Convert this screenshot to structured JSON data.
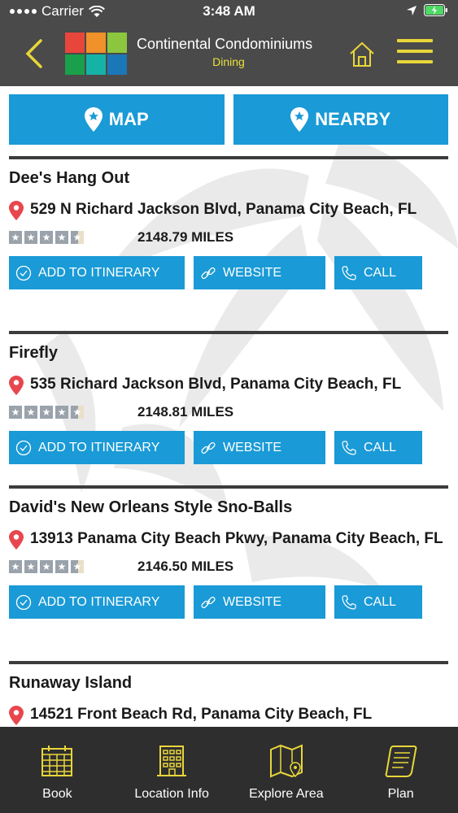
{
  "status_bar": {
    "carrier": "Carrier",
    "time": "3:48 AM"
  },
  "header": {
    "title": "Continental Condominiums",
    "subtitle": "Dining",
    "logo_colors": [
      "#e8463b",
      "#f0912a",
      "#8cc63f",
      "#1aa04a",
      "#15b3a6",
      "#1a78b8"
    ]
  },
  "actions": {
    "map_label": "MAP",
    "nearby_label": "NEARBY"
  },
  "listings": [
    {
      "name": "Dee's Hang Out",
      "address": "529 N Richard Jackson Blvd, Panama City Beach, FL",
      "distance": "2148.79 MILES",
      "rating": 4.5
    },
    {
      "name": "Firefly",
      "address": "535 Richard Jackson Blvd, Panama City Beach, FL",
      "distance": "2148.81 MILES",
      "rating": 4.5
    },
    {
      "name": "David's New Orleans Style Sno-Balls",
      "address": "13913 Panama City Beach Pkwy, Panama City Beach, FL",
      "distance": "2146.50 MILES",
      "rating": 4.5
    },
    {
      "name": "Runaway Island",
      "address": "14521 Front Beach Rd, Panama City Beach, FL",
      "distance": "",
      "rating": 0
    }
  ],
  "button_labels": {
    "itinerary": "ADD TO ITINERARY",
    "website": "WEBSITE",
    "call": "CALL"
  },
  "bottom_nav": [
    {
      "label": "Book",
      "icon": "calendar-icon"
    },
    {
      "label": "Location Info",
      "icon": "building-icon"
    },
    {
      "label": "Explore Area",
      "icon": "map-icon"
    },
    {
      "label": "Plan",
      "icon": "scroll-icon"
    }
  ],
  "colors": {
    "header_bg": "#4a4a4a",
    "accent_blue": "#1a9ad6",
    "accent_yellow": "#e8d63a",
    "pin_red": "#e8464e",
    "nav_bg": "#2e2e2e"
  }
}
